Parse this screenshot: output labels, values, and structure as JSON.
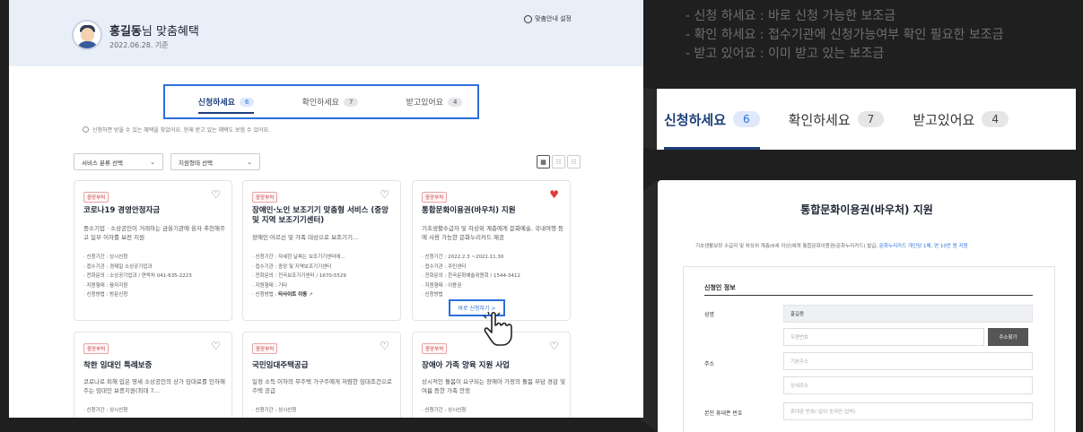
{
  "main": {
    "header": {
      "user_name": "홍길동",
      "title_suffix": "님 맞춤혜택",
      "date": "2022.06.28. 기준",
      "setting_label": "맞춤안내 설정"
    },
    "tabs": [
      {
        "label": "신청하세요",
        "count": "6",
        "active": true
      },
      {
        "label": "확인하세요",
        "count": "7",
        "active": false
      },
      {
        "label": "받고있어요",
        "count": "4",
        "active": false
      }
    ],
    "notice": "신청하면 받을 수 있는 혜택을 찾았어요. 현재 받고 있는 혜택도 보험 수 있어요.",
    "filters": {
      "category": "서비스 분류 선택",
      "support_type": "지원형태 선택"
    },
    "cards": [
      {
        "badge": "중앙부처",
        "title": "코로나19 경영안정자금",
        "desc": "중소기업 · 소상공인이 거래하는 금융기관에 융자 추천해주고 일부 이자를 보전 지원",
        "items": [
          "신청기간 : 상시신청",
          "접수기관 : 경제일 소상공기업과",
          "전화문의 : 소상공기업과 / 연락처 041-635-2223",
          "지원형태 : 융자지원",
          "신청방법 : 방문신청"
        ],
        "liked": false
      },
      {
        "badge": "중앙부처",
        "title": "장애인·노인 보조기기 맞춤형 서비스 (중앙 및 지역 보조기기센터)",
        "desc": "장애인·어르신 및 가족 대상으로 보조기기...",
        "items": [
          "신청기간 : 자세한 날짜는 보조기기센터에...",
          "접수기관 : 중앙 및 지역보조기기센터",
          "전화문의 : 전국보조기기센터 / 1670-5529",
          "지원형태 : 기타"
        ],
        "last_item_label": "신청방법 :",
        "last_item_link": "타사이트 이동",
        "liked": false
      },
      {
        "badge": "중앙부처",
        "title": "통합문화이용권(바우처) 지원",
        "desc": "기초생활수급자 및 차상위 계층에게 문화예술, 국내여행 등에 사용 가능한 문화누리카드 제공",
        "items": [
          "신청기간 : 2022.2.3 ~2022.11.30",
          "접수기관 : 주민센터",
          "전화문의 : 한국문화예술위원회 / 1544-3412",
          "지원형태 : 이용권",
          "신청방법"
        ],
        "liked": true
      },
      {
        "badge": "중앙부처",
        "title": "착한 임대인 특례보증",
        "desc": "코로나로 피해 입은 영세 소상공인의 상가 임대료를 인하해주는 임대인 보증지원(최대 7...",
        "items": [
          "신청기간 : 상시신청"
        ],
        "liked": false
      },
      {
        "badge": "중앙부처",
        "title": "국민임대주택공급",
        "desc": "일정 소득 이하의 무주택 가구주에게 저렴한 임대조건으로 주택 공급",
        "items": [
          "신청기간 : 상시신청"
        ],
        "liked": false
      },
      {
        "badge": "중앙부처",
        "title": "장애아 가족 양육 지원 사업",
        "desc": "상시적인 돌봄이 요구되는 장애아 가정의 돌봄 부담 경감 및 여름 등한 가족 안정",
        "items": [
          "신청기간 : 상시신청"
        ],
        "liked": false
      }
    ],
    "apply_button": "바로 신청하기 >"
  },
  "legend": [
    "- 신청 하세요 : 바로 신청 가능한 보조금",
    "- 확인 하세요 : 접수기관에 신청가능여부 확인 필요한 보조금",
    "- 받고 있어요 : 이미 받고 있는 보조금"
  ],
  "zoom_tabs": [
    {
      "label": "신청하세요",
      "count": "6",
      "active": true
    },
    {
      "label": "확인하세요",
      "count": "7",
      "active": false
    },
    {
      "label": "받고있어요",
      "count": "4",
      "active": false
    }
  ],
  "detail": {
    "title": "통합문화이용권(바우처) 지원",
    "desc_prefix": "기초생활보장 수급자 및 차상위 계층(6세 이상)에게 통합문화이용권(문화누리카드) 발급, ",
    "desc_highlight": "문화누리카드 개인당 1매, 연 10만 원 지원",
    "section": "신청인 정보",
    "name_label": "성명",
    "name_value": "홍길동",
    "zip_placeholder": "우편번호",
    "address_search": "주소찾기",
    "address_label": "주소",
    "base_address_placeholder": "기본주소",
    "detail_address_placeholder": "상세주소",
    "phone_label": "본인 휴대폰 번호",
    "phone_placeholder": "휴대폰 번호(-없이 숫자만 입력)"
  },
  "colors": {
    "accent": "#2b6fdc",
    "navy": "#1d3f7a",
    "heart_on": "#e23b3b",
    "background": "#1f1f1f"
  }
}
